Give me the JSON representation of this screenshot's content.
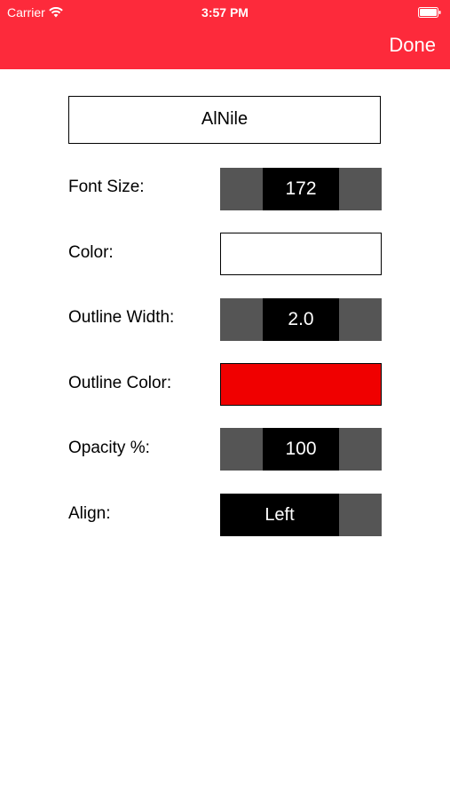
{
  "status_bar": {
    "carrier": "Carrier",
    "time": "3:57 PM"
  },
  "header": {
    "done_label": "Done",
    "background_color": "#fd2a3b"
  },
  "font_name": "AlNile",
  "rows": {
    "font_size": {
      "label": "Font Size:",
      "value": "172"
    },
    "color": {
      "label": "Color:",
      "swatch": "#ffffff"
    },
    "outline_width": {
      "label": "Outline Width:",
      "value": "2.0"
    },
    "outline_color": {
      "label": "Outline Color:",
      "swatch": "#f00000"
    },
    "opacity": {
      "label": "Opacity %:",
      "value": "100"
    },
    "align": {
      "label": "Align:",
      "value": "Left"
    }
  },
  "icons": {
    "wifi": "wifi-icon",
    "battery": "battery-icon"
  }
}
